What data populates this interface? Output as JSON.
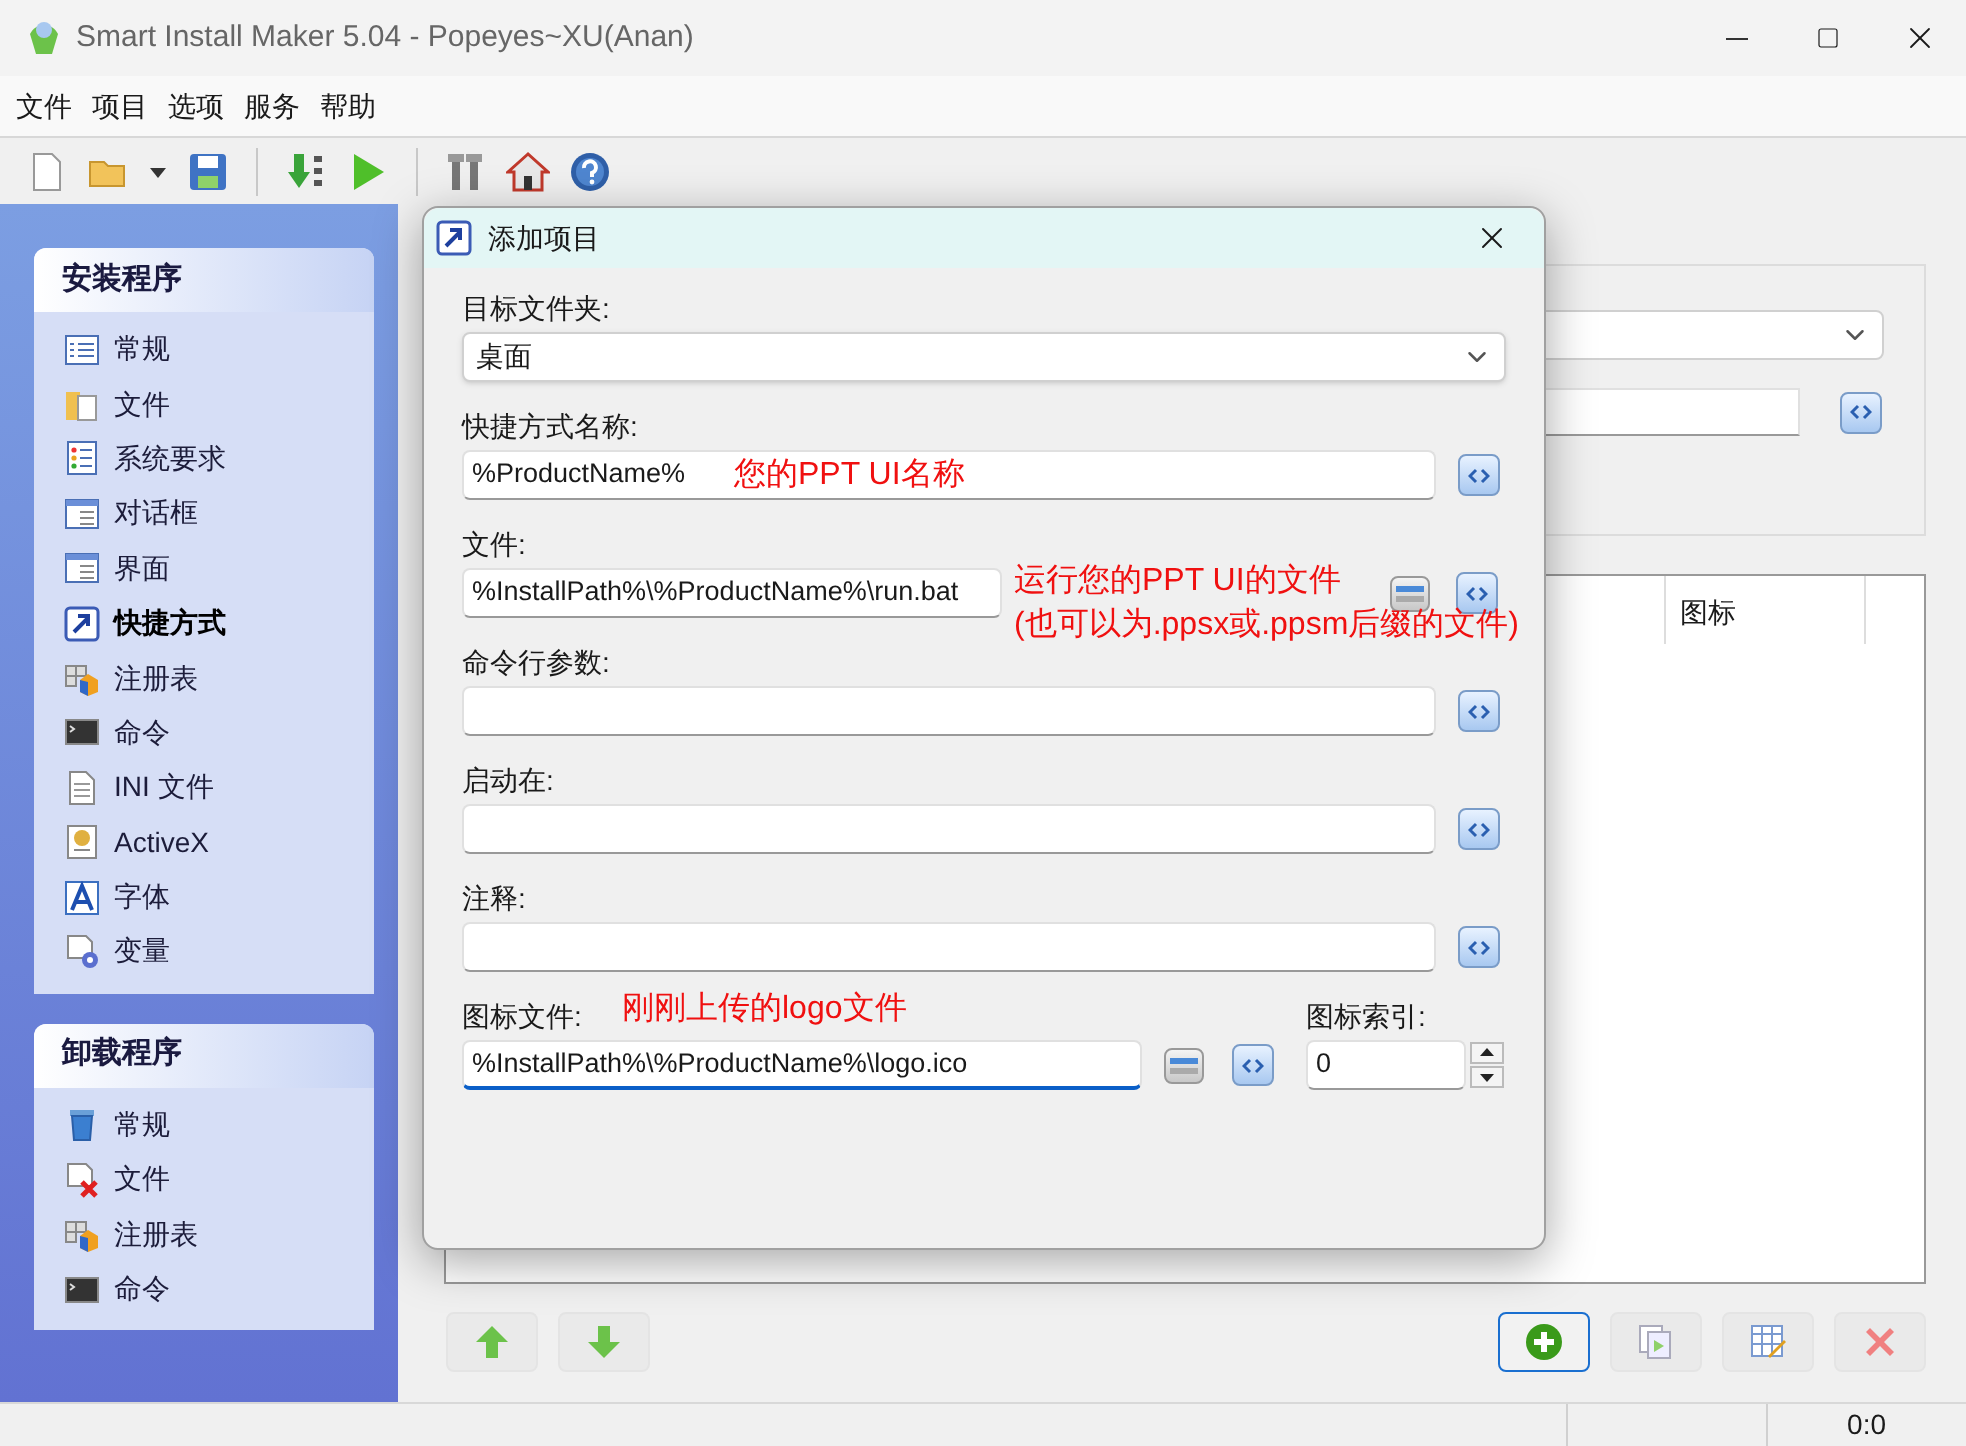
{
  "window": {
    "title": "Smart Install Maker 5.04 - Popeyes~XU(Anan)"
  },
  "menu": [
    "文件",
    "项目",
    "选项",
    "服务",
    "帮助"
  ],
  "toolbar": [
    {
      "kind": "new"
    },
    {
      "kind": "open"
    },
    {
      "kind": "dropdown"
    },
    {
      "kind": "save"
    },
    {
      "kind": "separator"
    },
    {
      "kind": "build"
    },
    {
      "kind": "run"
    },
    {
      "kind": "separator"
    },
    {
      "kind": "tools"
    },
    {
      "kind": "home"
    },
    {
      "kind": "help"
    }
  ],
  "sidebar": {
    "sections": [
      {
        "title": "安装程序",
        "items": [
          {
            "label": "常规",
            "selected": false
          },
          {
            "label": "文件",
            "selected": false
          },
          {
            "label": "系统要求",
            "selected": false
          },
          {
            "label": "对话框",
            "selected": false
          },
          {
            "label": "界面",
            "selected": false
          },
          {
            "label": "快捷方式",
            "selected": true
          },
          {
            "label": "注册表",
            "selected": false
          },
          {
            "label": "命令",
            "selected": false
          },
          {
            "label": "INI 文件",
            "selected": false
          },
          {
            "label": "ActiveX",
            "selected": false
          },
          {
            "label": "字体",
            "selected": false
          },
          {
            "label": "变量",
            "selected": false
          }
        ]
      },
      {
        "title": "卸载程序",
        "items": [
          {
            "label": "常规",
            "selected": false
          },
          {
            "label": "文件",
            "selected": false
          },
          {
            "label": "注册表",
            "selected": false
          },
          {
            "label": "命令",
            "selected": false
          }
        ]
      }
    ]
  },
  "list": {
    "columns": [
      "图标"
    ]
  },
  "bottom_buttons": [
    {
      "kind": "up",
      "focused": false
    },
    {
      "kind": "down",
      "focused": false
    },
    {
      "kind": "add",
      "focused": true
    },
    {
      "kind": "copy",
      "focused": false
    },
    {
      "kind": "edit",
      "focused": false
    },
    {
      "kind": "delete",
      "focused": false
    }
  ],
  "status_bar": {
    "position": "0:0"
  },
  "dialog": {
    "title": "添加项目",
    "fields": [
      {
        "label": "目标文件夹:",
        "kind": "select",
        "value": "桌面"
      },
      {
        "label": "快捷方式名称:",
        "kind": "text",
        "value": "%ProductName%",
        "annotation": [
          "您的PPT UI名称"
        ]
      },
      {
        "label": "文件:",
        "kind": "file",
        "value": "%InstallPath%\\%ProductName%\\run.bat",
        "annotation": [
          "运行您的PPT UI的文件",
          "(也可以为.ppsx或.ppsm后缀的文件)"
        ]
      },
      {
        "label": "命令行参数:",
        "kind": "text"
      },
      {
        "label": "启动在:",
        "kind": "text"
      },
      {
        "label": "注释:",
        "kind": "text"
      }
    ],
    "icon_file": {
      "label": "图标文件:",
      "value": "%InstallPath%\\%ProductName%\\logo.ico",
      "focused": true,
      "annotation": "刚刚上传的logo文件"
    },
    "icon_index": {
      "label": "图标索引:",
      "value": "0"
    }
  }
}
